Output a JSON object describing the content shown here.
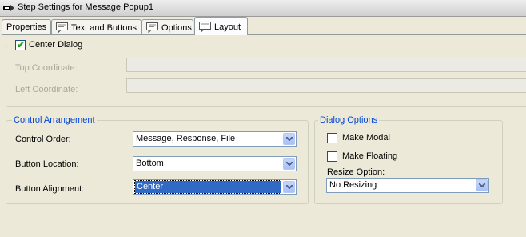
{
  "window": {
    "title": "Step Settings for Message Popup1"
  },
  "tabs": [
    {
      "label": "Properties",
      "has_icon": false,
      "active": false
    },
    {
      "label": "Text and Buttons",
      "has_icon": true,
      "active": false
    },
    {
      "label": "Options",
      "has_icon": true,
      "active": false
    },
    {
      "label": "Layout",
      "has_icon": true,
      "active": true
    }
  ],
  "position": {
    "center_dialog_label": "Center Dialog",
    "center_dialog_checked": true,
    "top_coordinate_label": "Top Coordinate:",
    "top_coordinate_value": "",
    "left_coordinate_label": "Left Coordinate:",
    "left_coordinate_value": ""
  },
  "control_arrangement": {
    "title": "Control Arrangement",
    "control_order_label": "Control Order:",
    "control_order_value": "Message, Response, File",
    "button_location_label": "Button Location:",
    "button_location_value": "Bottom",
    "button_alignment_label": "Button Alignment:",
    "button_alignment_value": "Center"
  },
  "dialog_options": {
    "title": "Dialog Options",
    "make_modal_label": "Make Modal",
    "make_modal_checked": false,
    "make_floating_label": "Make Floating",
    "make_floating_checked": false,
    "resize_option_label": "Resize Option:",
    "resize_option_value": "No Resizing"
  },
  "colors": {
    "accent_tab": "#e68b2c",
    "group_title": "#0046d5",
    "selection": "#316ac5",
    "check_mark": "#21a121"
  }
}
